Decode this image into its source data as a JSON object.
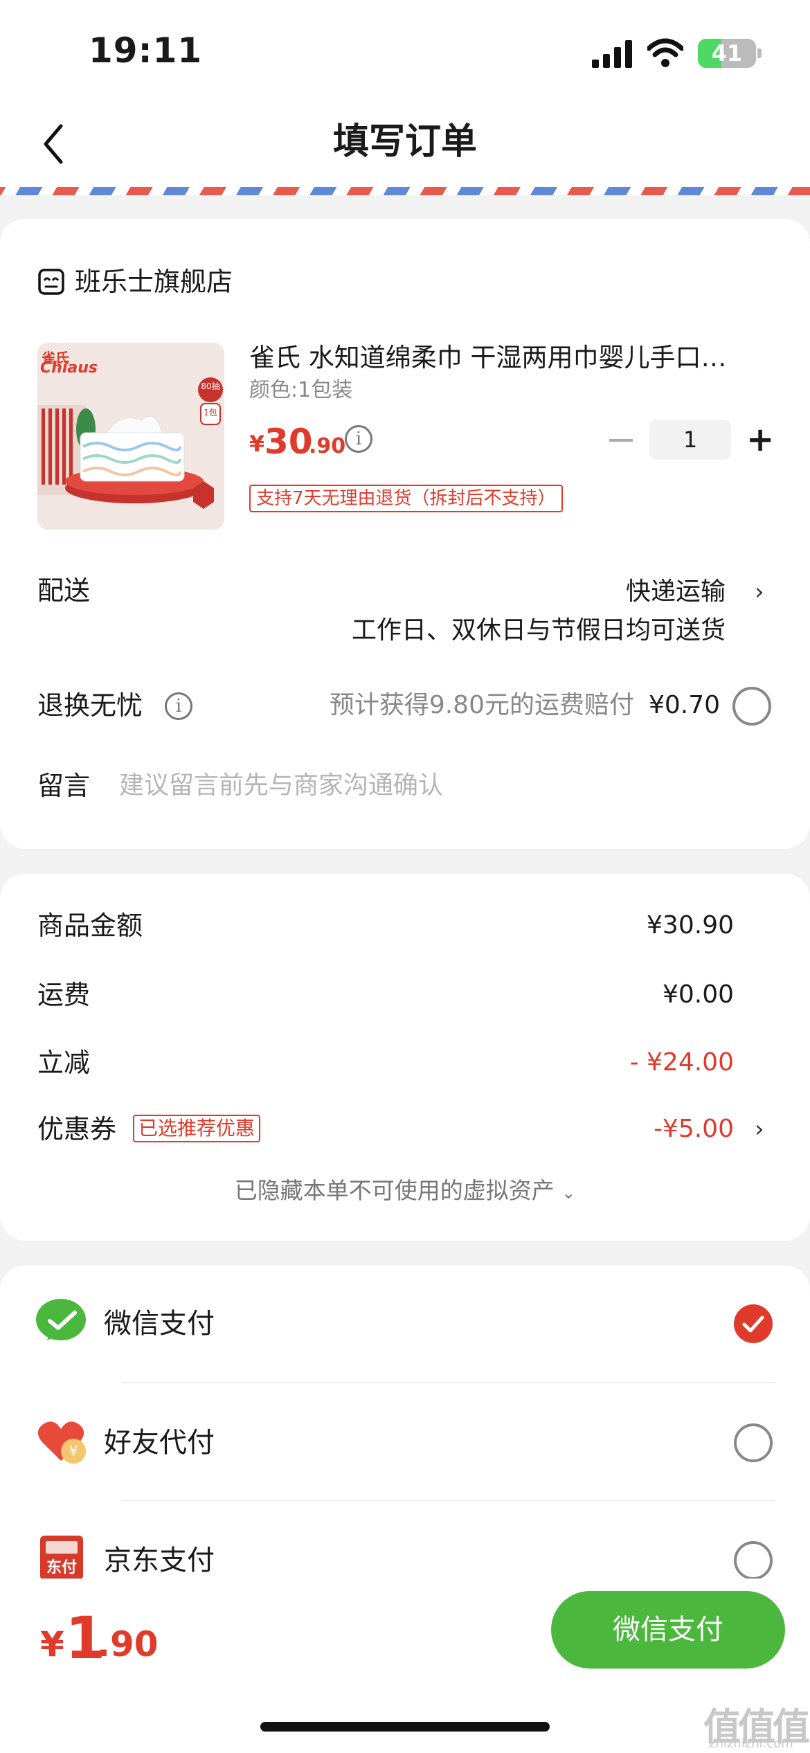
{
  "status_bar": {
    "time": "19:11",
    "battery": "41",
    "battery_level": 0.41
  },
  "nav": {
    "title": "填写订单"
  },
  "shop": {
    "name": "班乐士旗舰店"
  },
  "product": {
    "brand_logo_text": "Chiaus",
    "brand_logo_cn": "雀氏",
    "pack_badge_top": "80抽",
    "pack_badge_bottom": "1包",
    "title": "雀氏 水知道绵柔巾 干湿两用巾婴儿手口…",
    "variant": "颜色:1包装",
    "price_symbol": "¥",
    "price_int": "30",
    "price_dec": ".90",
    "quantity": "1",
    "return_policy": "支持7天无理由退货（拆封后不支持）"
  },
  "delivery": {
    "label": "配送",
    "method": "快递运输",
    "schedule": "工作日、双休日与节假日均可送货"
  },
  "worry_free": {
    "label": "退换无忧",
    "desc": "预计获得9.80元的运费赔付",
    "price": "¥0.70"
  },
  "message": {
    "label": "留言",
    "placeholder": "建议留言前先与商家沟通确认"
  },
  "summary": {
    "goods_label": "商品金额",
    "goods_value": "¥30.90",
    "shipping_label": "运费",
    "shipping_value": "¥0.00",
    "discount_label": "立减",
    "discount_value": "- ¥24.00",
    "coupon_label": "优惠券",
    "coupon_badge": "已选推荐优惠",
    "coupon_value": "-¥5.00",
    "hidden_assets": "已隐藏本单不可使用的虚拟资产"
  },
  "payment": {
    "methods": [
      {
        "label": "微信支付",
        "selected": true,
        "icon": "wechat-pay-icon"
      },
      {
        "label": "好友代付",
        "selected": false,
        "icon": "friend-pay-icon"
      },
      {
        "label": "京东支付",
        "selected": false,
        "icon": "jd-pay-icon",
        "icon_text": "东付"
      }
    ]
  },
  "footer": {
    "total_symbol": "¥",
    "total_int": "1",
    "total_dec": ".90",
    "pay_button": "微信支付"
  },
  "watermark": {
    "glyphs": "值值值",
    "url": "zhizhizhi.com"
  },
  "colors": {
    "accent_red": "#e03a2b",
    "wechat_green": "#4bb73c"
  }
}
